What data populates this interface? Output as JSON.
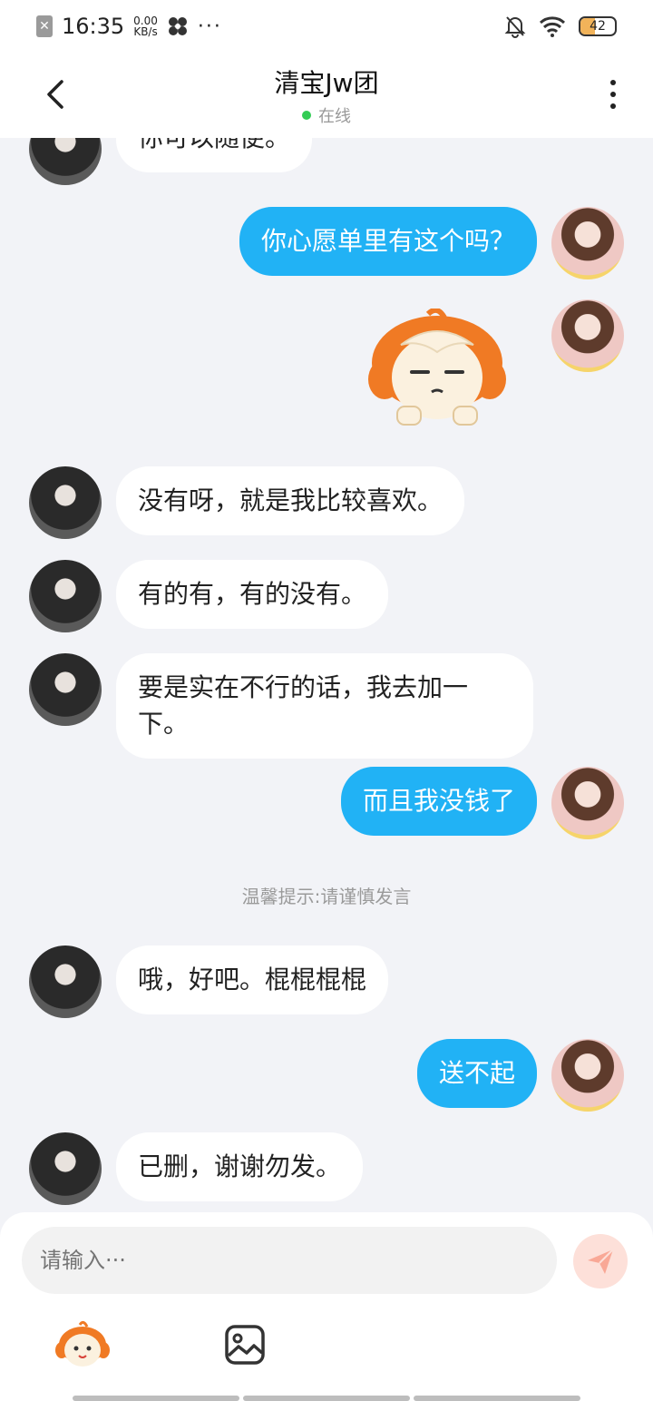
{
  "status_bar": {
    "time": "16:35",
    "net_speed_value": "0.00",
    "net_speed_unit": "KB/s",
    "more": "···",
    "battery": "42",
    "battery_level": 0.42
  },
  "header": {
    "title": "清宝Jw团",
    "status": "在线"
  },
  "messages": [
    {
      "side": "in",
      "text": "你可以随便。"
    },
    {
      "side": "out",
      "text": "你心愿单里有这个吗？"
    },
    {
      "side": "out",
      "type": "sticker",
      "sticker": "mascot-face-sticker"
    },
    {
      "side": "in",
      "text": "没有呀，就是我比较喜欢。"
    },
    {
      "side": "in",
      "text": "有的有，有的没有。"
    },
    {
      "side": "in",
      "text": "要是实在不行的话，我去加一下。"
    },
    {
      "side": "out",
      "text": "而且我没钱了"
    },
    {
      "side": "in",
      "text": "哦，好吧。棍棍棍棍"
    },
    {
      "side": "out",
      "text": "送不起"
    },
    {
      "side": "in",
      "text": "已删，谢谢勿发。"
    }
  ],
  "tip": "温馨提示:请谨慎发言",
  "input": {
    "placeholder": "请输入···"
  },
  "icons": {
    "back": "chevron-left-icon",
    "more": "more-vertical-icon",
    "send": "paper-plane-icon",
    "emoji": "emoji-mascot-icon",
    "image": "image-icon"
  },
  "colors": {
    "outgoing_bubble": "#21b2f5",
    "incoming_bubble": "#ffffff",
    "background": "#f2f3f7",
    "online_dot": "#33cc55",
    "send_button": "#fde0d9"
  }
}
